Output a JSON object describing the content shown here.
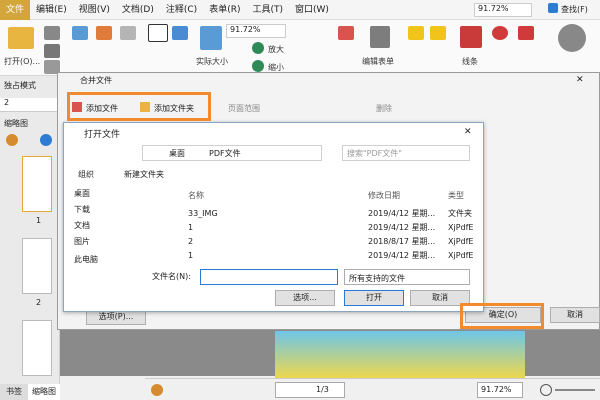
{
  "menubar": {
    "items": [
      "文件",
      "编辑(E)",
      "视图(V)",
      "文档(D)",
      "注释(C)",
      "表单(R)",
      "工具(T)",
      "窗口(W)"
    ],
    "active_index": 0,
    "search_label": "查找(F)",
    "zoom_value": "91.72%"
  },
  "ribbon": {
    "open_label": "打开(O)...",
    "actual_size_label": "实际大小",
    "zoom_in_label": "放大",
    "zoom_out_label": "缩小",
    "edit_form_label": "编辑表单",
    "line_label": "线条",
    "zoom_value": "91.72%"
  },
  "left_panel": {
    "mode_label": "独占模式",
    "page_num": "2",
    "thumbnail_label": "缩略图",
    "page_labels": [
      "1",
      "2"
    ],
    "tabs": [
      "书签",
      "缩略图"
    ]
  },
  "merge_dialog": {
    "title": "合并文件",
    "add_file_label": "添加文件",
    "add_folder_label": "添加文件夹",
    "page_range_label": "页面范围",
    "delete_label": "删除",
    "options_label": "选项(P)...",
    "ok_label": "确定(O)",
    "cancel_label": "取消"
  },
  "open_dialog": {
    "title": "打开文件",
    "breadcrumb": [
      "桌面",
      "PDF文件"
    ],
    "search_placeholder": "搜索\"PDF文件\"",
    "organize_label": "组织",
    "new_folder_label": "新建文件夹",
    "nav_items": [
      "桌面",
      "下载",
      "文档",
      "图片",
      "此电脑"
    ],
    "columns": {
      "name": "名称",
      "date": "修改日期",
      "type": "类型"
    },
    "files": [
      {
        "name": "33_IMG",
        "date": "2019/4/12 星期...",
        "type": "文件夹",
        "kind": "folder"
      },
      {
        "name": "1",
        "date": "2019/4/12 星期...",
        "type": "XjPdfE",
        "kind": "pdf"
      },
      {
        "name": "2",
        "date": "2018/8/17 星期...",
        "type": "XjPdfE",
        "kind": "pdf"
      },
      {
        "name": "1",
        "date": "2019/4/12 星期...",
        "type": "XjPdfE",
        "kind": "pdf"
      }
    ],
    "filename_label": "文件名(N):",
    "filetype_value": "所有支持的文件",
    "options_label": "选项...",
    "open_label": "打开",
    "cancel_label": "取消"
  },
  "bottom_bar": {
    "page_display": "1/3",
    "zoom_value": "91.72%"
  },
  "colors": {
    "highlight": "#f28a2e",
    "active_menu": "#d2a63a",
    "blue": "#1e73d6"
  }
}
